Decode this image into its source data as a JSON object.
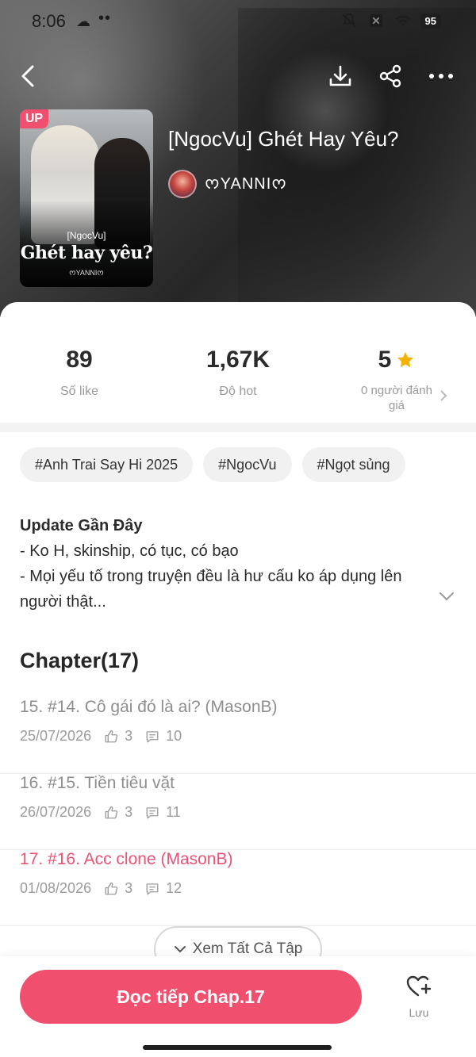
{
  "status_bar": {
    "time": "8:06",
    "battery": "95"
  },
  "book": {
    "badge": "UP",
    "cover_subtitle": "[NgocVu]",
    "cover_title": "Ghét hay yêu?",
    "cover_author": "ᰔYANNIᰔ",
    "title": "[NgocVu] Ghét Hay Yêu?",
    "author": "ᰔYANNIᰔ"
  },
  "stats": [
    {
      "value": "89",
      "label": "Số like"
    },
    {
      "value": "1,67K",
      "label": "Độ hot"
    },
    {
      "value": "5",
      "label": "0 người đánh giá"
    }
  ],
  "tags": [
    "#Anh Trai Say Hi 2025",
    "#NgocVu",
    "#Ngọt sủng"
  ],
  "description": {
    "title": "Update Gần Đây",
    "line1": "- Ko H, skinship, có tục, có bạo",
    "line2": "- Mọi yếu tố trong truyện đều là hư cấu ko áp dụng lên người thật..."
  },
  "chapters_header": "Chapter(17)",
  "chapters": [
    {
      "name": "15. #14. Cô gái đó là ai? (MasonB)",
      "date": "25/07/2026",
      "likes": "3",
      "comments": "10",
      "current": false
    },
    {
      "name": "16. #15. Tiền tiêu vặt",
      "date": "26/07/2026",
      "likes": "3",
      "comments": "11",
      "current": false
    },
    {
      "name": "17. #16. Acc clone (MasonB)",
      "date": "01/08/2026",
      "likes": "3",
      "comments": "12",
      "current": true
    }
  ],
  "see_all_label": "Xem Tất Cả Tập",
  "bottom": {
    "read_label": "Đọc tiếp Chap.17",
    "save_label": "Lưu"
  },
  "colors": {
    "accent": "#f0506e",
    "star": "#f5b301"
  },
  "icons": [
    "back-icon",
    "download-icon",
    "share-icon",
    "more-icon",
    "star-icon",
    "chevron-right-icon",
    "chevron-down-icon",
    "thumb-up-icon",
    "comment-icon",
    "heart-plus-icon"
  ]
}
